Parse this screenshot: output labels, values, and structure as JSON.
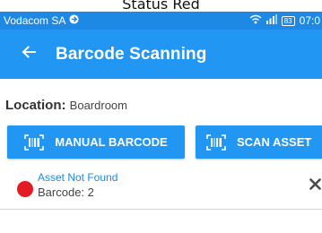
{
  "caption": {
    "text": "Status Red"
  },
  "status_bar": {
    "carrier": "Vodacom SA",
    "battery": "83",
    "time": "07:0"
  },
  "app_bar": {
    "title": "Barcode Scanning",
    "back_icon": "arrow-left-icon"
  },
  "location": {
    "label": "Location:",
    "value": "Boardroom"
  },
  "buttons": {
    "manual_label": "MANUAL BARCODE",
    "scan_label": "SCAN ASSET",
    "icon": "barcode-icon"
  },
  "results": [
    {
      "title": "Asset Not Found",
      "barcode_label": "Barcode: 2",
      "status_color": "#e31b23",
      "remove_icon": "close-icon"
    }
  ],
  "colors": {
    "primary": "#2196f3",
    "status_bar": "#1e88e5",
    "error": "#e31b23"
  }
}
